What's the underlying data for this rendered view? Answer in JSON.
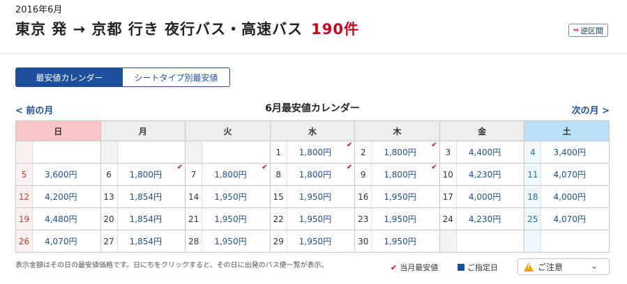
{
  "header": {
    "period": "2016年6月",
    "title": "東京 発 → 京都 行き 夜行バス・高速バス",
    "count": "190件",
    "reverse_label": "逆区間"
  },
  "tabs": [
    {
      "label": "最安値カレンダー",
      "active": true
    },
    {
      "label": "シートタイプ別最安値",
      "active": false
    }
  ],
  "nav": {
    "prev": "< 前の月",
    "next": "次の月 >",
    "calendar_title": "6月最安値カレンダー"
  },
  "weekdays": [
    "日",
    "月",
    "火",
    "水",
    "木",
    "金",
    "土"
  ],
  "weeks": [
    [
      {
        "day": "",
        "price": "",
        "check": false
      },
      {
        "day": "",
        "price": "",
        "check": false
      },
      {
        "day": "",
        "price": "",
        "check": false
      },
      {
        "day": "1",
        "price": "1,800円",
        "check": true
      },
      {
        "day": "2",
        "price": "1,800円",
        "check": true
      },
      {
        "day": "3",
        "price": "4,400円",
        "check": false
      },
      {
        "day": "4",
        "price": "3,400円",
        "check": false
      }
    ],
    [
      {
        "day": "5",
        "price": "3,600円",
        "check": false
      },
      {
        "day": "6",
        "price": "1,800円",
        "check": true
      },
      {
        "day": "7",
        "price": "1,800円",
        "check": true
      },
      {
        "day": "8",
        "price": "1,800円",
        "check": true
      },
      {
        "day": "9",
        "price": "1,800円",
        "check": true
      },
      {
        "day": "10",
        "price": "4,230円",
        "check": false
      },
      {
        "day": "11",
        "price": "4,070円",
        "check": false
      }
    ],
    [
      {
        "day": "12",
        "price": "4,200円",
        "check": false
      },
      {
        "day": "13",
        "price": "1,854円",
        "check": false
      },
      {
        "day": "14",
        "price": "1,950円",
        "check": false
      },
      {
        "day": "15",
        "price": "1,950円",
        "check": false
      },
      {
        "day": "16",
        "price": "1,950円",
        "check": false
      },
      {
        "day": "17",
        "price": "4,000円",
        "check": false
      },
      {
        "day": "18",
        "price": "4,000円",
        "check": false
      }
    ],
    [
      {
        "day": "19",
        "price": "4,480円",
        "check": false
      },
      {
        "day": "20",
        "price": "1,854円",
        "check": false
      },
      {
        "day": "21",
        "price": "1,950円",
        "check": false
      },
      {
        "day": "22",
        "price": "1,950円",
        "check": false
      },
      {
        "day": "23",
        "price": "1,950円",
        "check": false
      },
      {
        "day": "24",
        "price": "4,230円",
        "check": false
      },
      {
        "day": "25",
        "price": "4,070円",
        "check": false
      }
    ],
    [
      {
        "day": "26",
        "price": "4,070円",
        "check": false
      },
      {
        "day": "27",
        "price": "1,854円",
        "check": false
      },
      {
        "day": "28",
        "price": "1,950円",
        "check": false
      },
      {
        "day": "29",
        "price": "1,950円",
        "check": false
      },
      {
        "day": "30",
        "price": "1,950円",
        "check": false
      },
      {
        "day": "",
        "price": "",
        "check": false
      },
      {
        "day": "",
        "price": "",
        "check": false
      }
    ]
  ],
  "footer": {
    "note": "表示金額はその日の最安値価格です。日にちをクリックすると、その日に出発のバス便一覧が表示。",
    "legend_lowest": "当月最安値",
    "legend_selected": "ご指定日",
    "notice_label": "ご注意"
  },
  "colors": {
    "brand": "#1d4f9c",
    "count_red": "#d0021b",
    "sunday_header": "#f8c5c7",
    "saturday_header": "#b8e1f7"
  }
}
